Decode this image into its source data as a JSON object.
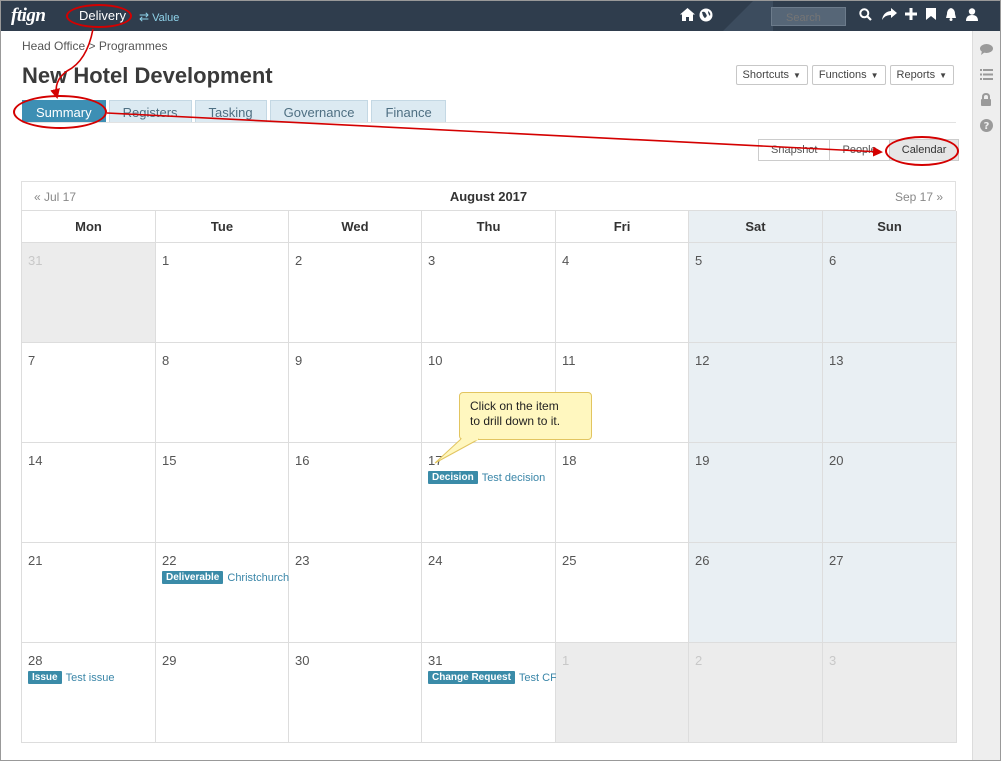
{
  "app": {
    "logo_brand": "ftign",
    "module": "Delivery",
    "switch_label": "Value"
  },
  "topbar": {
    "search_placeholder": "Search"
  },
  "breadcrumb": "Head Office > Programmes",
  "page_title": "New Hotel Development",
  "header_buttons": [
    "Shortcuts",
    "Functions",
    "Reports"
  ],
  "tabs": [
    "Summary",
    "Registers",
    "Tasking",
    "Governance",
    "Finance"
  ],
  "active_tab": "Summary",
  "view_buttons": [
    "Snapshot",
    "People",
    "Calendar"
  ],
  "active_view": "Calendar",
  "calendar": {
    "prev": "« Jul 17",
    "month": "August 2017",
    "next": "Sep 17 »",
    "weekdays": [
      "Mon",
      "Tue",
      "Wed",
      "Thu",
      "Fri",
      "Sat",
      "Sun"
    ],
    "weeks": [
      [
        {
          "n": "31",
          "other": true
        },
        {
          "n": "1"
        },
        {
          "n": "2"
        },
        {
          "n": "3"
        },
        {
          "n": "4"
        },
        {
          "n": "5"
        },
        {
          "n": "6"
        }
      ],
      [
        {
          "n": "7"
        },
        {
          "n": "8"
        },
        {
          "n": "9"
        },
        {
          "n": "10"
        },
        {
          "n": "11"
        },
        {
          "n": "12"
        },
        {
          "n": "13"
        }
      ],
      [
        {
          "n": "14"
        },
        {
          "n": "15"
        },
        {
          "n": "16"
        },
        {
          "n": "17",
          "event": {
            "tag": "Decision",
            "title": "Test decision"
          }
        },
        {
          "n": "18"
        },
        {
          "n": "19"
        },
        {
          "n": "20"
        }
      ],
      [
        {
          "n": "21"
        },
        {
          "n": "22",
          "event": {
            "tag": "Deliverable",
            "title": "Christchurch"
          }
        },
        {
          "n": "23"
        },
        {
          "n": "24"
        },
        {
          "n": "25"
        },
        {
          "n": "26"
        },
        {
          "n": "27"
        }
      ],
      [
        {
          "n": "28",
          "event": {
            "tag": "Issue",
            "title": "Test issue"
          }
        },
        {
          "n": "29"
        },
        {
          "n": "30"
        },
        {
          "n": "31",
          "event": {
            "tag": "Change Request",
            "title": "Test CF"
          }
        },
        {
          "n": "1",
          "other": true
        },
        {
          "n": "2",
          "other": true
        },
        {
          "n": "3",
          "other": true
        }
      ]
    ]
  },
  "callout": {
    "line1": "Click on the item",
    "line2": "to drill down to it."
  },
  "icons": {
    "topbar": [
      "home-icon",
      "globe-icon",
      "search-icon",
      "share-icon",
      "add-icon",
      "bookmark-icon",
      "bell-icon",
      "user-icon"
    ],
    "rail": [
      "comment-icon",
      "list-icon",
      "lock-icon",
      "help-icon"
    ]
  },
  "colors": {
    "topbar": "#2f3d4d",
    "accent": "#3d8fb4",
    "tag": "#3a8ba8",
    "annotation": "#d40000",
    "callout": "#fff7bf"
  }
}
